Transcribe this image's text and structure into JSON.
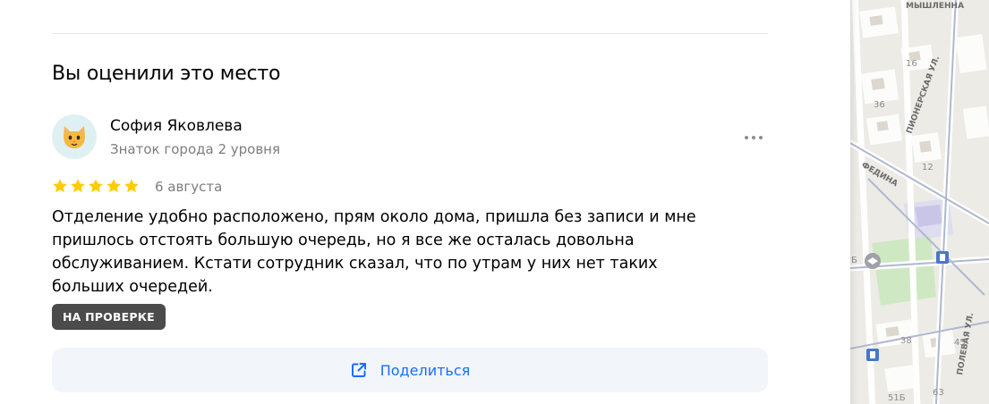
{
  "section": {
    "heading": "Вы оценили это место"
  },
  "review": {
    "author_name": "София Яковлева",
    "author_level": "Знаток города 2 уровня",
    "avatar": "cat-face-emoji",
    "rating": 5,
    "rating_max": 5,
    "date": "6 августа",
    "text": "Отделение удобно расположено, прям около дома, пришла без записи и мне пришлось отстоять большую очередь, но я все же осталась довольна обслуживанием. Кстати сотрудник сказал, что по утрам у них нет таких больших очередей.",
    "status_badge": "НА ПРОВЕРКЕ",
    "more_icon": "more-dots-icon"
  },
  "share": {
    "label": "Поделиться",
    "icon": "share-icon"
  },
  "colors": {
    "accent": "#196dff",
    "star": "#ffcc00",
    "badge_bg": "#4b4b4b",
    "share_bg": "#f2f5fa"
  },
  "map": {
    "street_labels": [
      "МЫШЛЕННА",
      "ПИОНЕРСКАЯ УЛ.",
      "ФЕДИНА",
      "ПОЛЕВАЯ УЛ."
    ],
    "house_numbers": [
      "16",
      "36",
      "12",
      "38",
      "45",
      "51Б",
      "63",
      "Б"
    ]
  }
}
